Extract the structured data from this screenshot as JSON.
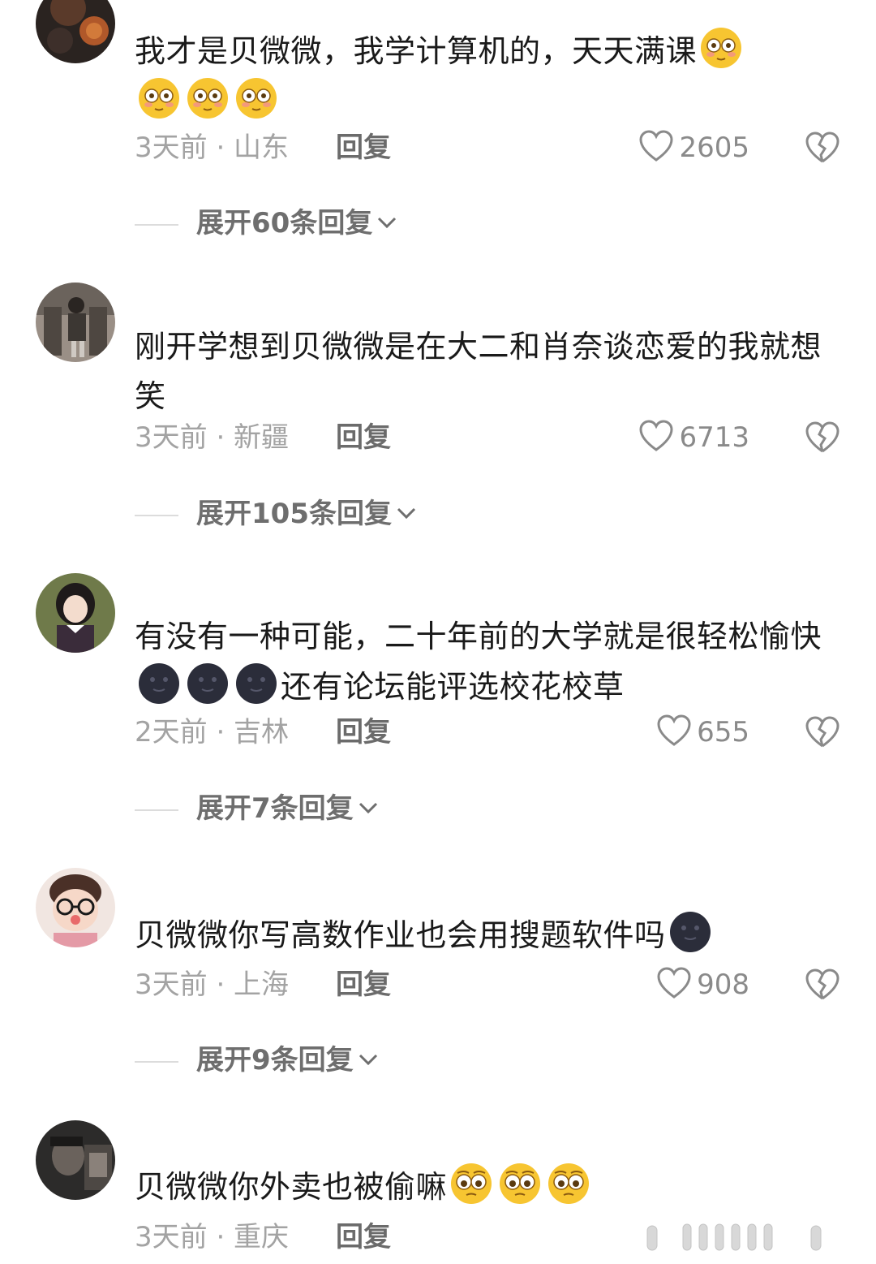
{
  "comments": [
    {
      "text_before": "我才是贝微微，我学计算机的，天天满课",
      "emojis": [
        "flushed-emoji",
        "flushed-emoji",
        "flushed-emoji",
        "flushed-emoji"
      ],
      "text_after": "",
      "time_location": "3天前 · 山东",
      "reply_label": "回复",
      "likes": "2605",
      "expand_label": "展开60条回复"
    },
    {
      "text_before": "刚开学想到贝微微是在大二和肖奈谈恋爱的我就想笑",
      "emojis": [],
      "text_after": "",
      "time_location": "3天前 · 新疆",
      "reply_label": "回复",
      "likes": "6713",
      "expand_label": "展开105条回复"
    },
    {
      "text_before": "有没有一种可能，二十年前的大学就是很轻松愉快",
      "emojis": [
        "dark-moon-emoji",
        "dark-moon-emoji",
        "dark-moon-emoji"
      ],
      "text_after": "还有论坛能评选校花校草",
      "time_location": "2天前 · 吉林",
      "reply_label": "回复",
      "likes": "655",
      "expand_label": "展开7条回复"
    },
    {
      "text_before": "贝微微你写高数作业也会用搜题软件吗",
      "emojis": [
        "dark-moon-emoji"
      ],
      "text_after": "",
      "time_location": "3天前 · 上海",
      "reply_label": "回复",
      "likes": "908",
      "expand_label": "展开9条回复"
    },
    {
      "text_before": "贝微微你外卖也被偷嘛",
      "emojis": [
        "pleading-emoji",
        "pleading-emoji",
        "pleading-emoji"
      ],
      "text_after": "",
      "time_location": "3天前 · 重庆",
      "reply_label": "回复"
    }
  ],
  "icons": {
    "like": "heart-outline-icon",
    "dislike": "broken-heart-icon",
    "expand": "chevron-down-icon"
  },
  "colors": {
    "text": "#1a1a1a",
    "meta": "#a3a3a3",
    "reply": "#6b6b6b",
    "expand": "#6e6e6e"
  }
}
